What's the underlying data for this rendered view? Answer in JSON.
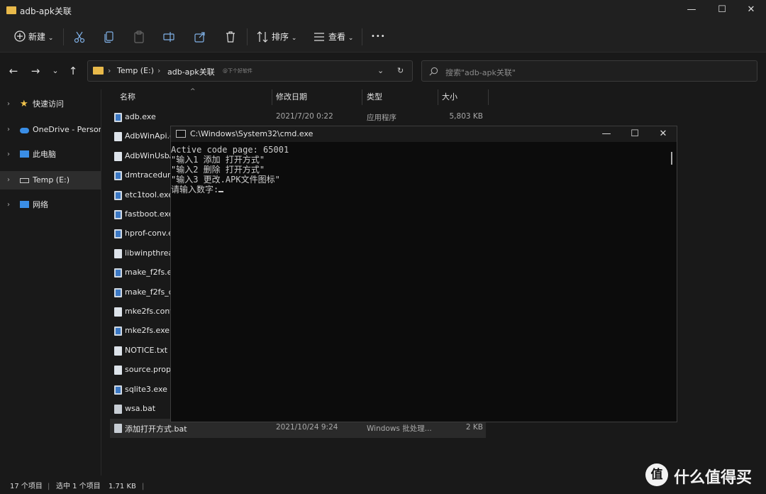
{
  "window": {
    "title": "adb-apk关联",
    "minimize": "—",
    "maximize": "☐",
    "close": "✕"
  },
  "toolbar": {
    "new_label": "新建",
    "sort_label": "排序",
    "view_label": "查看",
    "more_label": "•••"
  },
  "address": {
    "drive": "Temp (E:)",
    "folder": "adb-apk关联",
    "watermark_text": "@下个好软件",
    "search_placeholder": "搜索\"adb-apk关联\""
  },
  "sidebar": {
    "items": [
      {
        "label": "快速访问",
        "icon": "star-icon"
      },
      {
        "label": "OneDrive - Personal",
        "icon": "cloud-icon"
      },
      {
        "label": "此电脑",
        "icon": "pc-icon"
      },
      {
        "label": "Temp (E:)",
        "icon": "drive-icon",
        "selected": true
      },
      {
        "label": "网络",
        "icon": "network-icon"
      }
    ]
  },
  "columns": {
    "name": "名称",
    "date": "修改日期",
    "type": "类型",
    "size": "大小"
  },
  "files": [
    {
      "name": "adb.exe",
      "date": "2021/7/20 0:22",
      "type": "应用程序",
      "size": "5,803 KB",
      "kind": "exe"
    },
    {
      "name": "AdbWinApi.dll",
      "kind": "dll"
    },
    {
      "name": "AdbWinUsbApi.dll",
      "kind": "dll"
    },
    {
      "name": "dmtracedump.exe",
      "kind": "exe"
    },
    {
      "name": "etc1tool.exe",
      "kind": "exe"
    },
    {
      "name": "fastboot.exe",
      "kind": "exe"
    },
    {
      "name": "hprof-conv.exe",
      "kind": "exe"
    },
    {
      "name": "libwinpthread-1.dll",
      "kind": "dll"
    },
    {
      "name": "make_f2fs.exe",
      "kind": "exe"
    },
    {
      "name": "make_f2fs_casefold.exe",
      "kind": "exe"
    },
    {
      "name": "mke2fs.conf",
      "kind": "doc"
    },
    {
      "name": "mke2fs.exe",
      "kind": "exe"
    },
    {
      "name": "NOTICE.txt",
      "kind": "doc"
    },
    {
      "name": "source.properties",
      "kind": "doc"
    },
    {
      "name": "sqlite3.exe",
      "kind": "exe"
    },
    {
      "name": "wsa.bat",
      "kind": "bat"
    },
    {
      "name": "添加打开方式.bat",
      "date": "2021/10/24 9:24",
      "type": "Windows 批处理...",
      "size": "2 KB",
      "kind": "bat",
      "selected": true
    }
  ],
  "status": {
    "count": "17 个项目",
    "selection": "选中 1 个项目",
    "size": "1.71 KB"
  },
  "cmd": {
    "title": "C:\\Windows\\System32\\cmd.exe",
    "lines": [
      "Active code page: 65001",
      "\"输入1 添加 打开方式\"",
      "\"输入2 删除 打开方式\"",
      "\"输入3 更改.APK文件图标\"",
      "请输入数字:"
    ]
  },
  "watermark": {
    "text": "什么值得买",
    "logo": "值"
  }
}
